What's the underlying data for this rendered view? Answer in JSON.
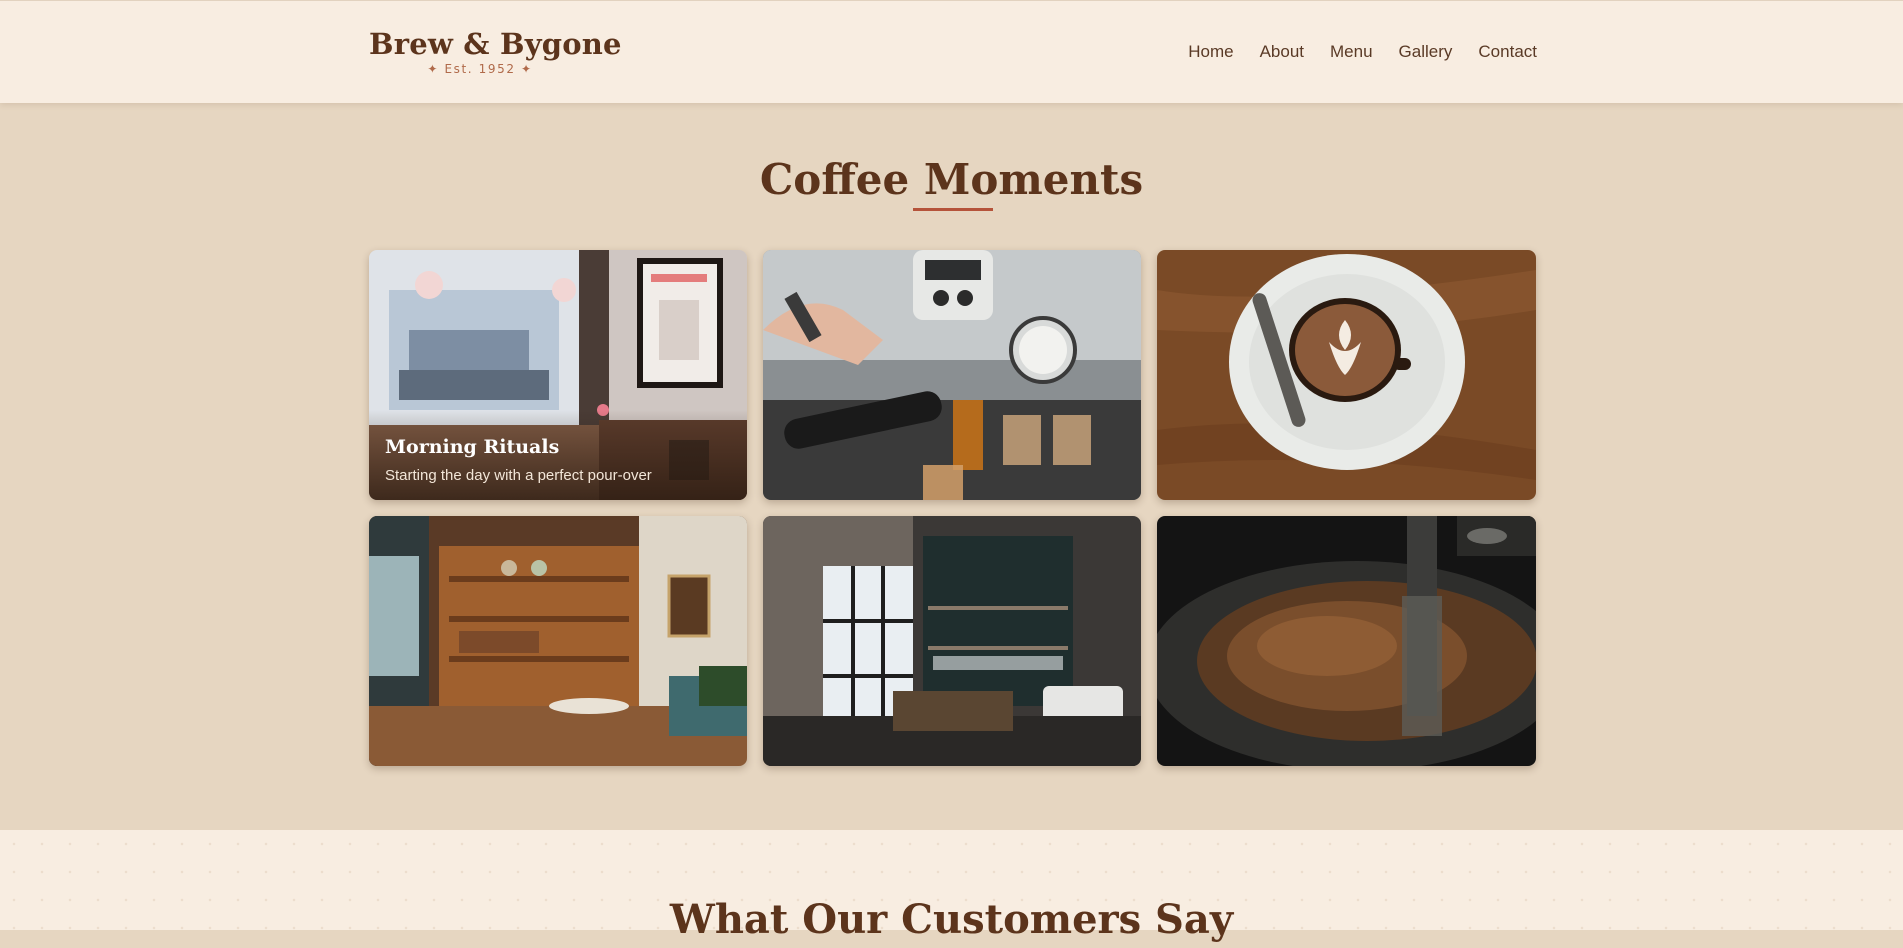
{
  "brand": {
    "name": "Brew & Bygone",
    "tagline": "✦ Est. 1952 ✦"
  },
  "nav": {
    "items": [
      {
        "label": "Home"
      },
      {
        "label": "About"
      },
      {
        "label": "Menu"
      },
      {
        "label": "Gallery"
      },
      {
        "label": "Contact"
      }
    ]
  },
  "gallery": {
    "title": "Coffee Moments",
    "tiles": [
      {
        "photo": "cafe-window-interior",
        "caption_title": "Morning Rituals",
        "caption_text": "Starting the day with a perfect pour-over"
      },
      {
        "photo": "espresso-machine-brewing"
      },
      {
        "photo": "latte-art-cup"
      },
      {
        "photo": "bookshelf-cafe-interior"
      },
      {
        "photo": "modern-coffee-bar"
      },
      {
        "photo": "coffee-bean-roaster"
      }
    ]
  },
  "testimonials": {
    "title": "What Our Customers Say"
  },
  "colors": {
    "header_bg": "#f8ede1",
    "section_bg": "#e6d6c1",
    "brand_brown": "#5c341c",
    "accent": "#b5533a"
  }
}
